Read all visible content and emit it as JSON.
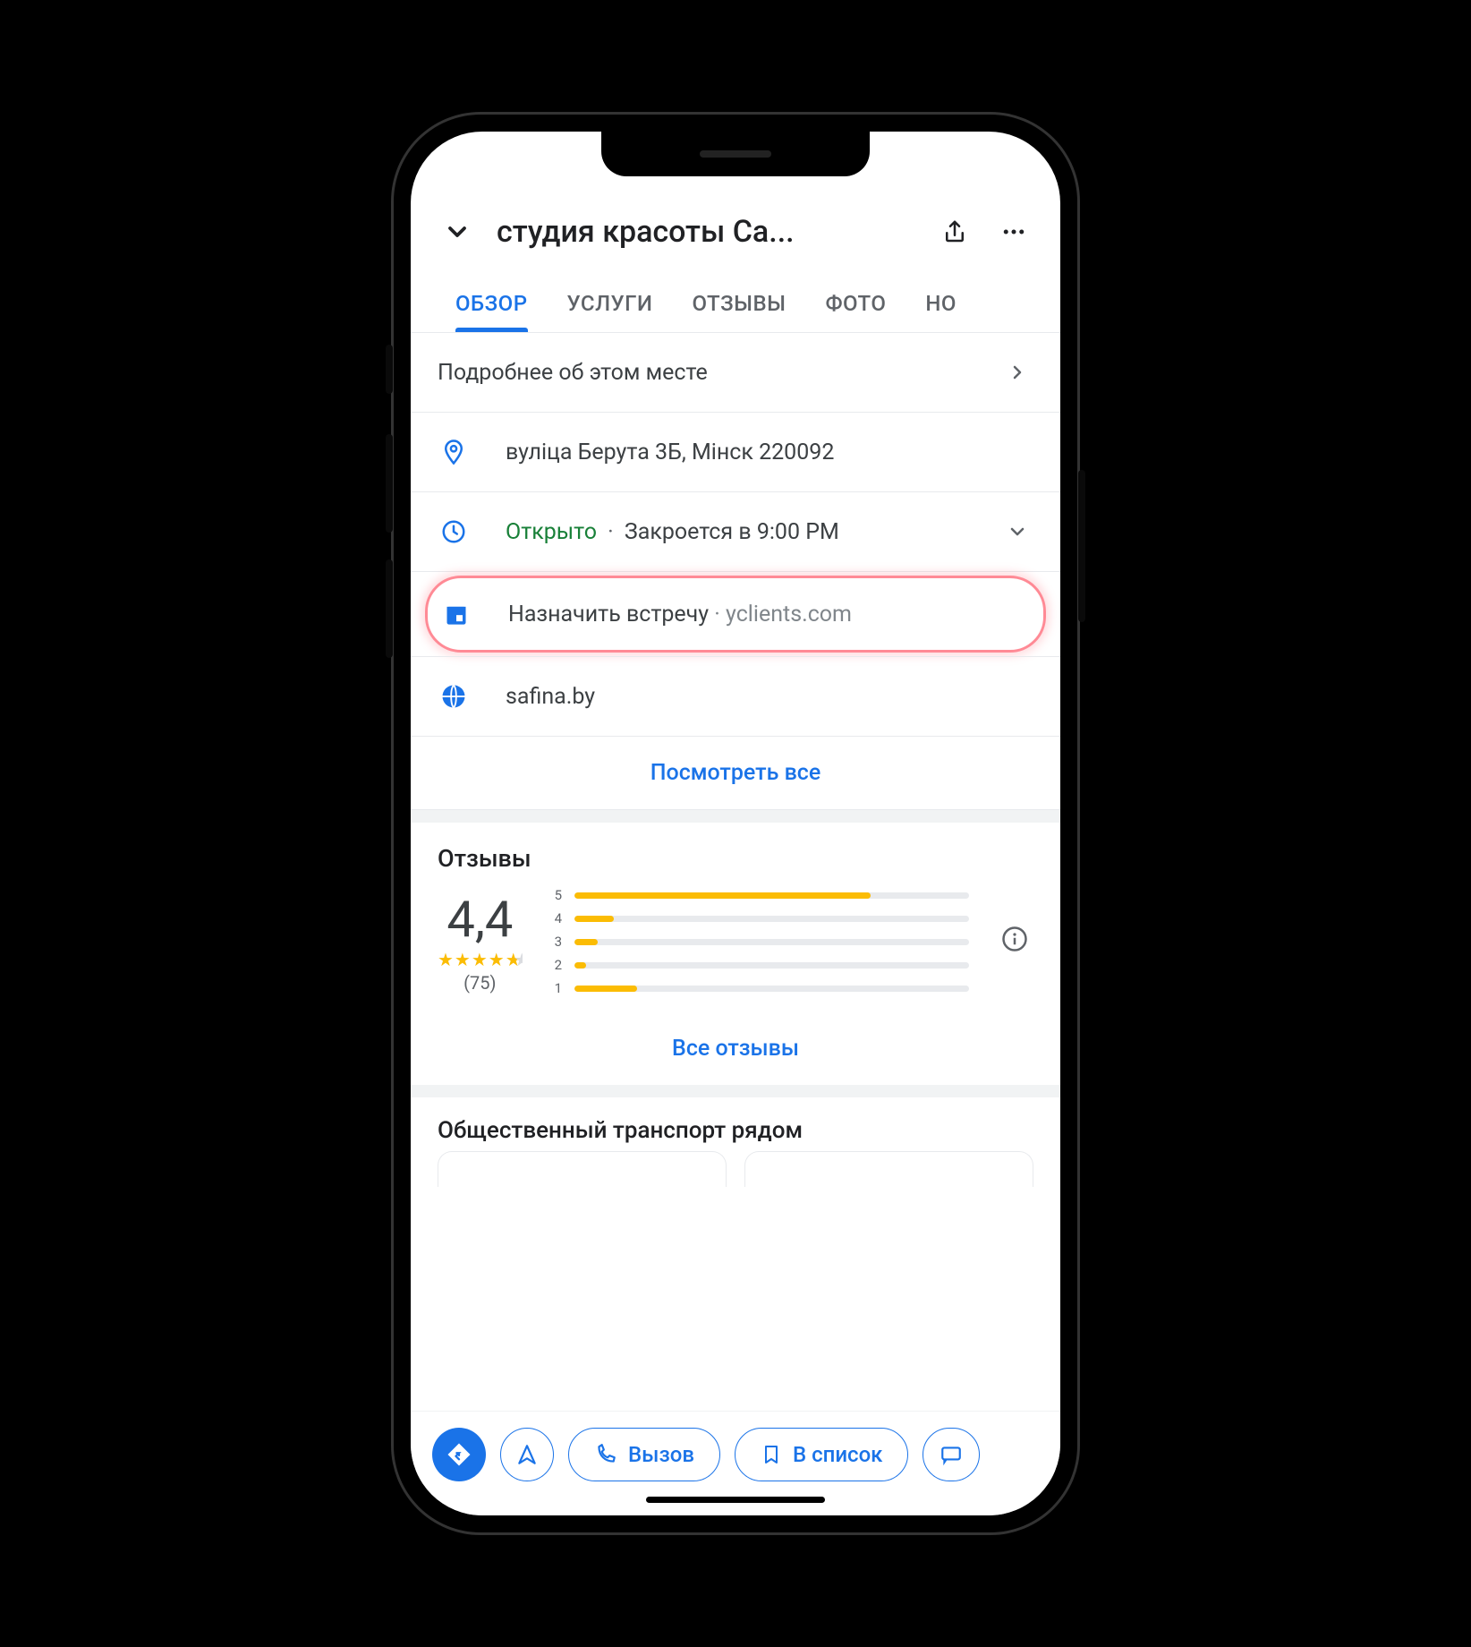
{
  "header": {
    "title": "студия красоты Са..."
  },
  "tabs": {
    "t1": "ОБЗОР",
    "t2": "УСЛУГИ",
    "t3": "ОТЗЫВЫ",
    "t4": "ФОТО",
    "t5": "НО"
  },
  "about_row": "Подробнее об этом месте",
  "address": "вуліца Берута 3Б, Мінск 220092",
  "hours": {
    "status": "Открыто",
    "closes": "Закроется в 9:00 PM"
  },
  "appointment": {
    "label": "Назначить встречу",
    "provider": "yclients.com"
  },
  "website": "safina.by",
  "view_all": "Посмотреть все",
  "reviews": {
    "title": "Отзывы",
    "rating": "4,4",
    "count": "(75)",
    "bars": {
      "b5": 75,
      "b4": 10,
      "b3": 6,
      "b2": 3,
      "b1": 16
    },
    "all": "Все отзывы"
  },
  "transit_title": "Общественный транспорт рядом",
  "bottom": {
    "call": "Вызов",
    "save": "В список"
  }
}
